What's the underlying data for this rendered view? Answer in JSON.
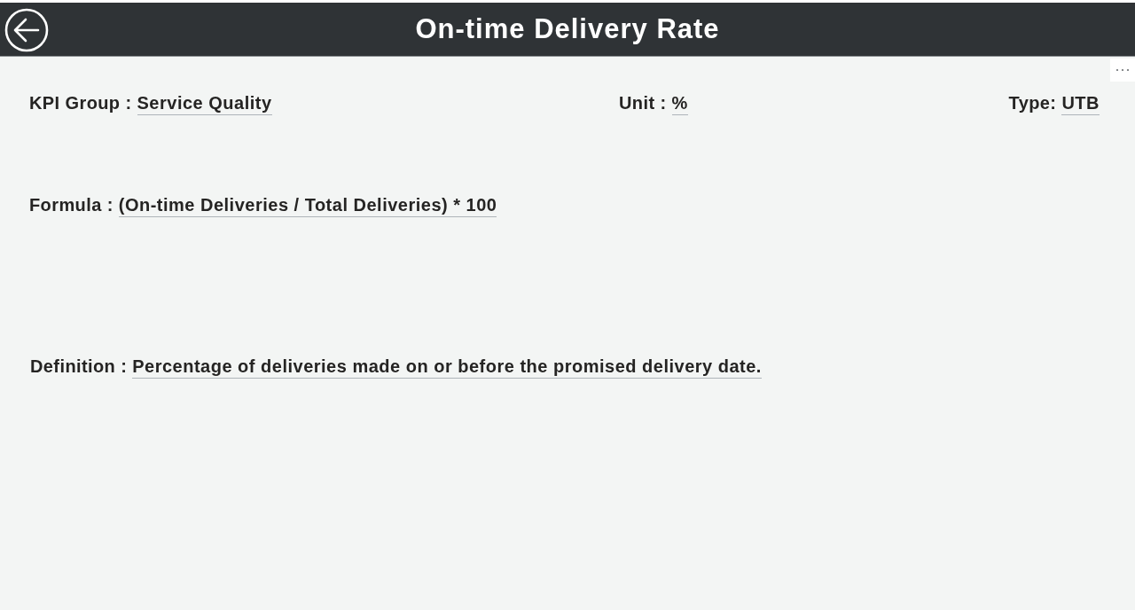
{
  "header": {
    "title": "On-time Delivery Rate"
  },
  "summary_fields": [
    {
      "label": "KPI Group :",
      "value": "Service Quality"
    },
    {
      "label": "Unit :",
      "value": "%"
    },
    {
      "label": "Type:",
      "value": "UTB"
    }
  ],
  "formula": {
    "label": "Formula :",
    "value": "(On-time Deliveries / Total Deliveries) * 100"
  },
  "definition": {
    "label": "Definition :",
    "value": "Percentage of deliveries made on or before the promised delivery date."
  }
}
